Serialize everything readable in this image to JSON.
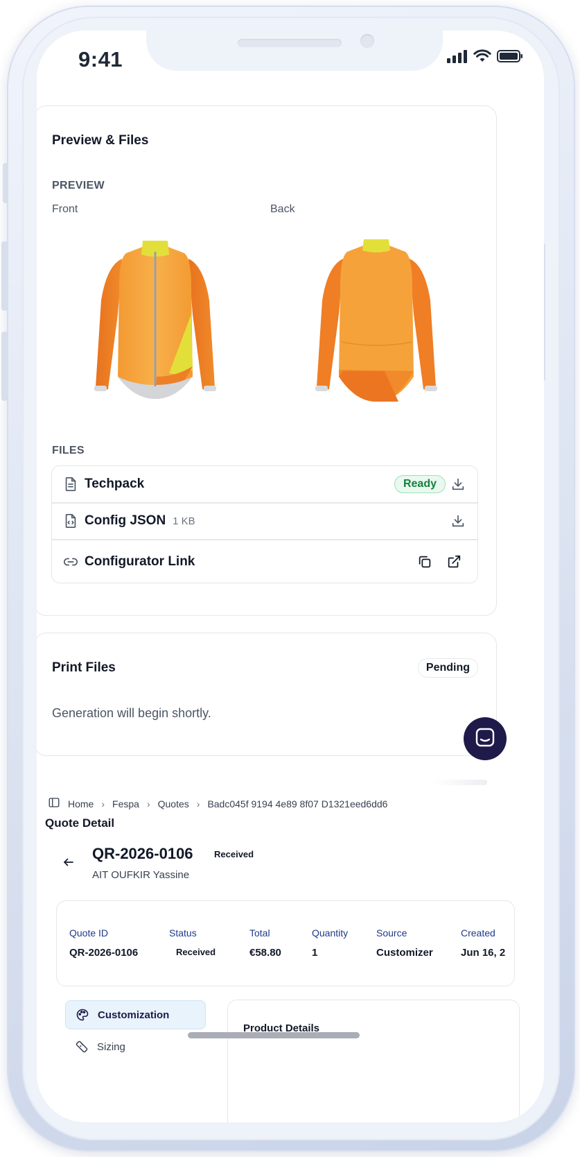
{
  "status_bar": {
    "time": "9:41"
  },
  "preview_files": {
    "title": "Preview & Files",
    "preview_label": "PREVIEW",
    "front_label": "Front",
    "back_label": "Back",
    "files_label": "FILES",
    "files": [
      {
        "name": "Techpack",
        "status": "Ready",
        "icon": "document-icon",
        "action": "download-icon"
      },
      {
        "name": "Config JSON",
        "size": "1 KB",
        "icon": "code-file-icon",
        "action": "download-icon"
      },
      {
        "name": "Configurator Link",
        "icon": "link-icon",
        "actions": [
          "copy-icon",
          "external-link-icon"
        ]
      }
    ]
  },
  "print_files": {
    "title": "Print Files",
    "status": "Pending",
    "message": "Generation will begin shortly."
  },
  "breadcrumb": [
    "Home",
    "Fespa",
    "Quotes",
    "Badc045f 9194 4e89 8f07 D1321eed6dd6"
  ],
  "page": {
    "heading": "Quote Detail",
    "quote_number": "QR-2026-0106",
    "quote_status": "Received",
    "customer": "AIT OUFKIR Yassine"
  },
  "summary": {
    "columns": [
      {
        "label": "Quote ID",
        "value": "QR-2026-0106"
      },
      {
        "label": "Status",
        "value": "Received"
      },
      {
        "label": "Total",
        "value": "€58.80"
      },
      {
        "label": "Quantity",
        "value": "1"
      },
      {
        "label": "Source",
        "value": "Customizer"
      },
      {
        "label": "Created",
        "value": "Jun 16, 2"
      }
    ]
  },
  "tabs": [
    {
      "label": "Customization",
      "icon": "palette-icon",
      "active": true
    },
    {
      "label": "Sizing",
      "icon": "ruler-icon",
      "active": false
    }
  ],
  "product": {
    "title": "Product Details"
  },
  "colors": {
    "jacket_orange": "#f08a2a",
    "jacket_light": "#f6a63c",
    "jacket_yellow": "#e3df3a",
    "ready_green": "#15803d",
    "fab_navy": "#1e1b4b"
  }
}
